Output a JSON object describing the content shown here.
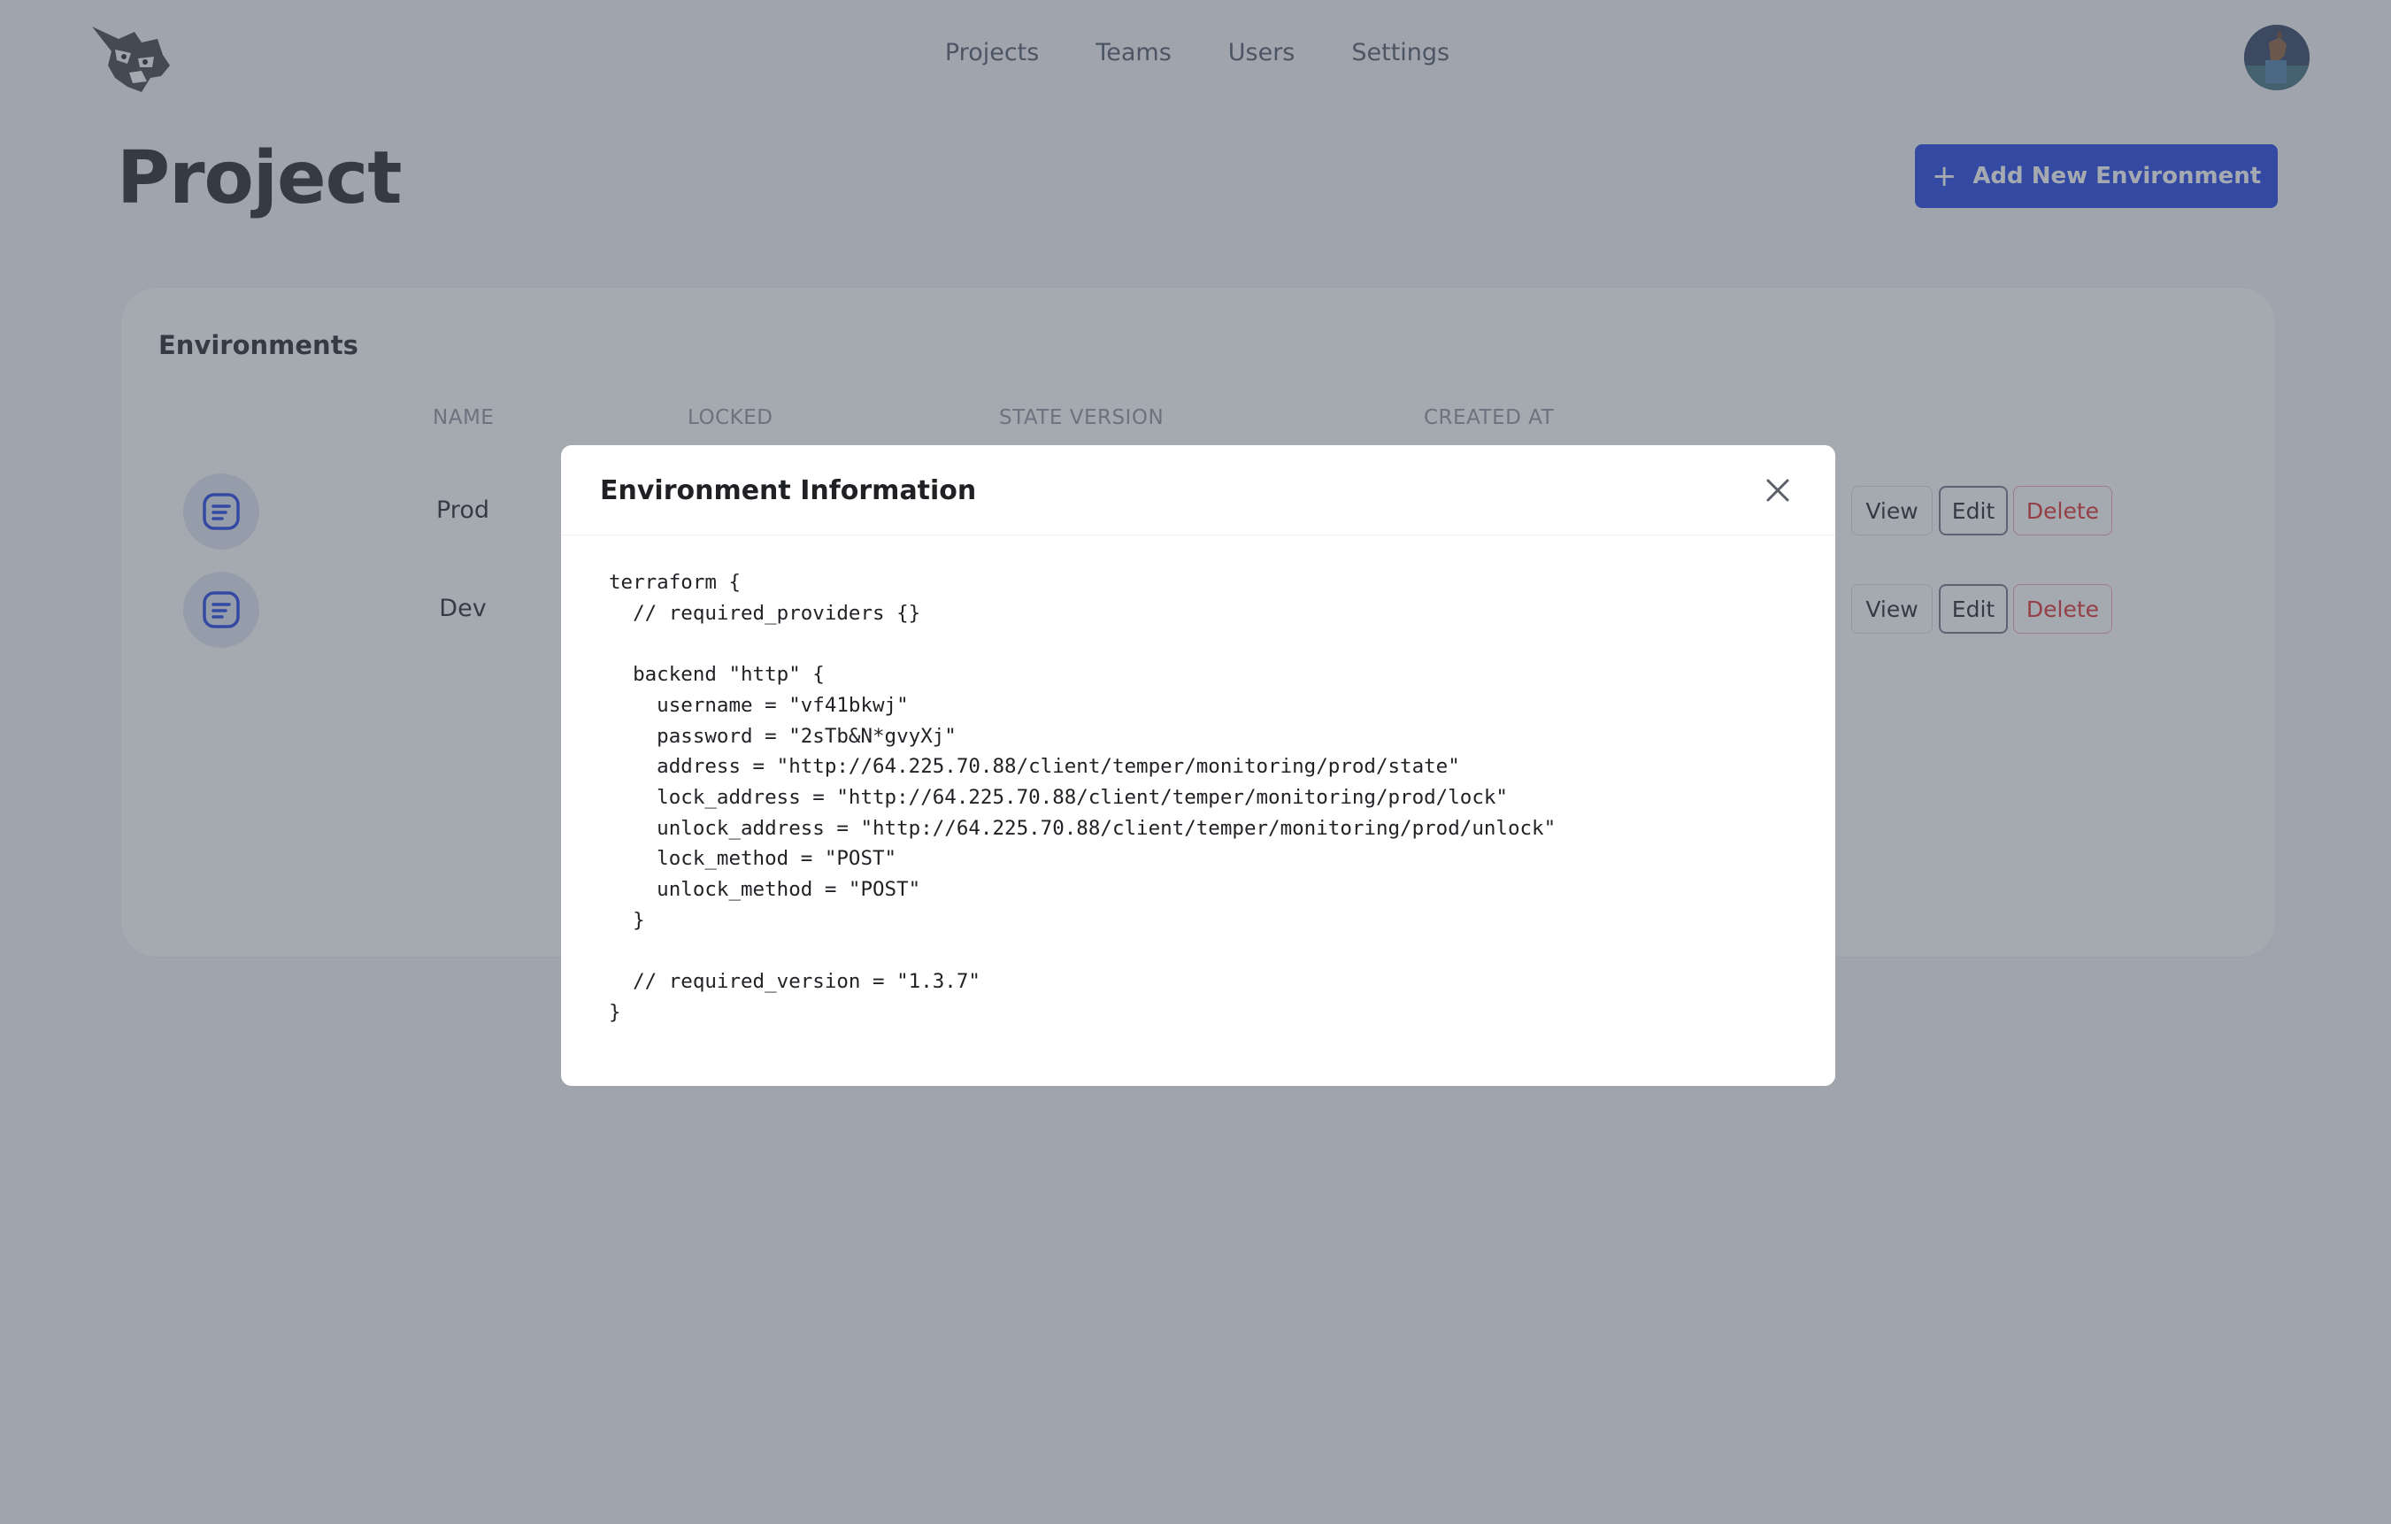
{
  "nav": {
    "items": [
      "Projects",
      "Teams",
      "Users",
      "Settings"
    ]
  },
  "page": {
    "title": "Project",
    "add_button_label": "Add New Environment"
  },
  "environments": {
    "title": "Environments",
    "columns": [
      "NAME",
      "LOCKED",
      "STATE VERSION",
      "CREATED AT"
    ],
    "rows": [
      {
        "name": "Prod",
        "actions": [
          "View",
          "Edit",
          "Delete"
        ]
      },
      {
        "name": "Dev",
        "actions": [
          "View",
          "Edit",
          "Delete"
        ]
      }
    ]
  },
  "modal": {
    "title": "Environment Information",
    "code": "terraform {\n  // required_providers {}\n\n  backend \"http\" {\n    username = \"vf41bkwj\"\n    password = \"2sTb&N*gvyXj\"\n    address = \"http://64.225.70.88/client/temper/monitoring/prod/state\"\n    lock_address = \"http://64.225.70.88/client/temper/monitoring/prod/lock\"\n    unlock_address = \"http://64.225.70.88/client/temper/monitoring/prod/unlock\"\n    lock_method = \"POST\"\n    unlock_method = \"POST\"\n  }\n\n  // required_version = \"1.3.7\"\n}"
  },
  "colors": {
    "accent": "#1d3fe0",
    "danger": "#dc2626",
    "overlay": "rgba(75,85,99,0.5)"
  },
  "icons": {
    "logo": "lynx-logo",
    "env": "document-lines-icon",
    "close": "close-icon",
    "add": "plus-icon"
  }
}
